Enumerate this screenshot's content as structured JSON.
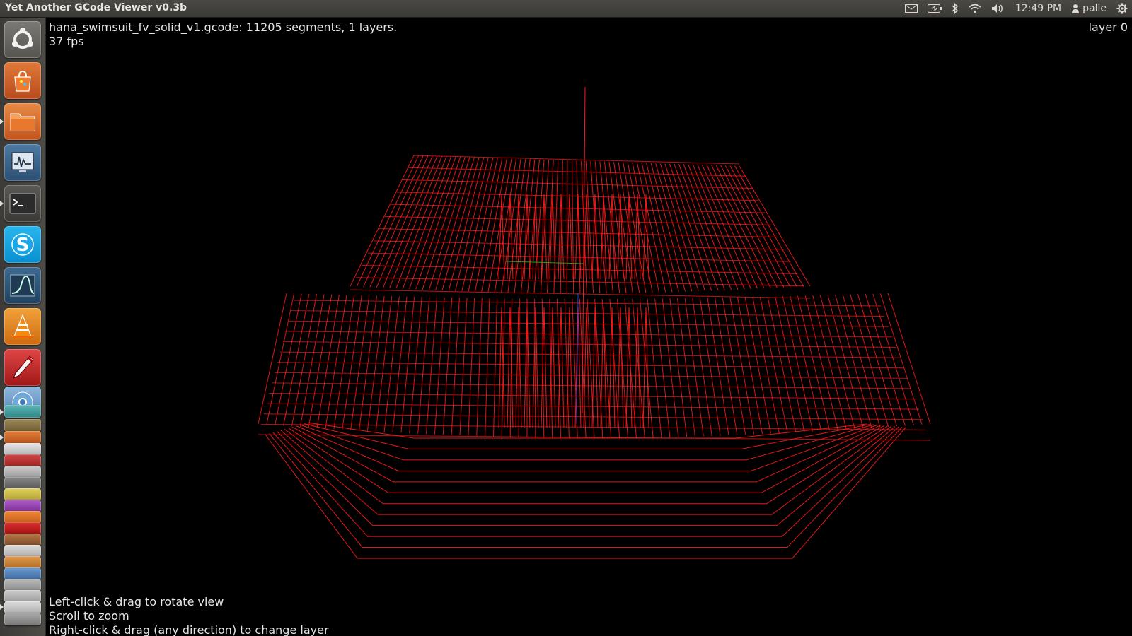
{
  "window": {
    "title": "Yet Another GCode Viewer v0.3b"
  },
  "tray": {
    "icons": [
      "mail-icon",
      "battery-icon",
      "bluetooth-icon",
      "wifi-icon",
      "volume-icon"
    ],
    "time": "12:49 PM",
    "user": "palle",
    "settings_icon": "gear-icon"
  },
  "launcher": {
    "apps": [
      "dash-icon",
      "software-center-icon",
      "files-icon",
      "system-monitor-icon",
      "terminal-icon",
      "skype-icon",
      "scope-icon",
      "vlc-icon",
      "pen-icon"
    ],
    "stacked_apps": [
      "chromium-icon",
      "arduino-icon",
      "app-icon",
      "app-icon",
      "app-icon",
      "app-icon",
      "app-icon",
      "app-icon",
      "app-icon",
      "app-icon",
      "app-icon",
      "app-icon",
      "app-icon",
      "app-icon",
      "app-icon",
      "app-icon"
    ]
  },
  "viewer": {
    "file_status": "hana_swimsuit_fv_solid_v1.gcode: 11205 segments, 1 layers.",
    "fps": "37 fps",
    "layer": "layer 0",
    "help": [
      "Left-click & drag to rotate view",
      "Scroll to zoom",
      "Right-click & drag (any direction) to change layer"
    ],
    "colors": {
      "toolpath": "#ff1a1a",
      "background": "#000000",
      "axis_y": "#22aa22",
      "axis_z": "#3355ff"
    }
  }
}
